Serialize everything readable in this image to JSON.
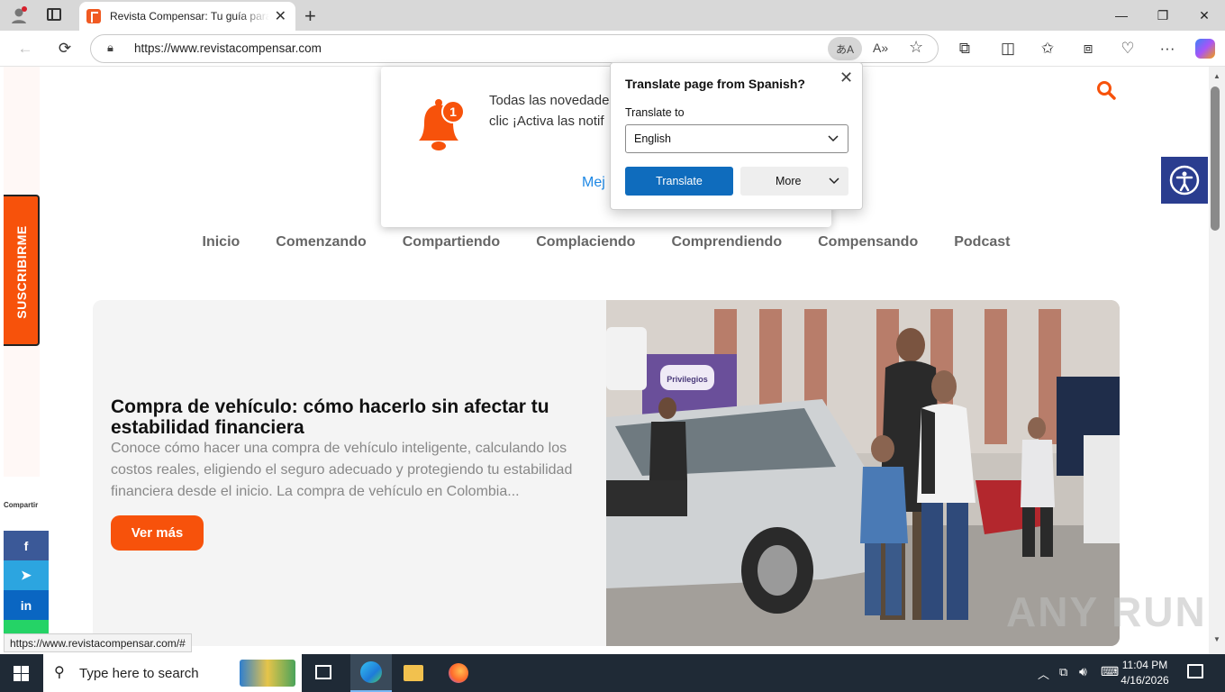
{
  "browser": {
    "tab_title": "Revista Compensar: Tu guía para ahorrar",
    "url": "https://www.revistacompensar.com",
    "translate_badge": "あA",
    "status_url": "https://www.revistacompensar.com/#"
  },
  "page": {
    "subscribe_label": "SUSCRIBIRME",
    "share_label": "Compartir",
    "share_items": [
      "facebook-icon",
      "telegram-icon",
      "linkedin-icon"
    ],
    "nav_items": [
      "Inicio",
      "Comenzando",
      "Compartiendo",
      "Complaciendo",
      "Comprendiendo",
      "Compensando",
      "Podcast"
    ],
    "hero_title": "Compra de vehículo: cómo hacerlo sin afectar tu estabilidad financiera",
    "hero_description": "Conoce cómo hacer una compra de vehículo inteligente, calculando los costos reales, eligiendo el seguro adecuado y protegiendo tu estabilidad financiera desde el inicio.  La compra de vehículo en Colombia...",
    "hero_button": "Ver más",
    "hero_image_sign": "Privilegios",
    "watermark": "ANY RUN",
    "brand_color": "#f7520b"
  },
  "notification_prompt": {
    "badge_count": "1",
    "text_line1": "Todas las novedades",
    "text_line2": "clic ¡Activa las notif",
    "link_partial": "Mej"
  },
  "translate_popup": {
    "title": "Translate page from Spanish?",
    "label": "Translate to",
    "selected_language": "English",
    "translate_button": "Translate",
    "more_button": "More"
  },
  "taskbar": {
    "search_placeholder": "Type here to search",
    "time": "11:04 PM",
    "date": "4/16/2026"
  }
}
